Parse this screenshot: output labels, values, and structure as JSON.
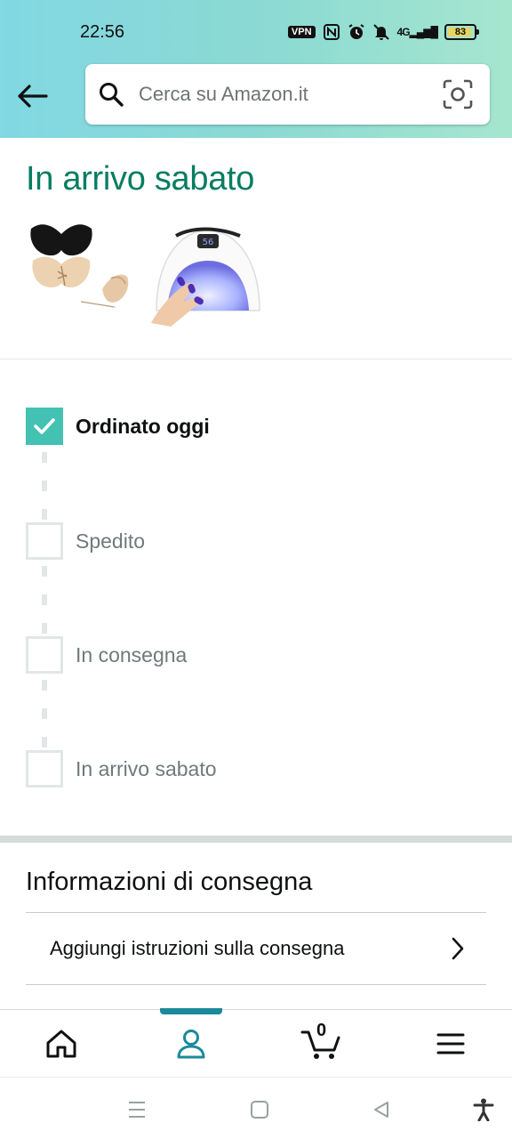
{
  "status_bar": {
    "time": "22:56",
    "vpn": "VPN",
    "network": "4G",
    "battery": "83"
  },
  "header": {
    "search_placeholder": "Cerca su Amazon.it",
    "accent": "#067D62"
  },
  "delivery": {
    "title": "In arrivo sabato",
    "products": [
      {
        "name": "bra-product-thumbnail"
      },
      {
        "name": "nail-lamp-product-thumbnail"
      }
    ]
  },
  "tracker": {
    "steps": [
      {
        "label": "Ordinato oggi",
        "done": true
      },
      {
        "label": "Spedito",
        "done": false
      },
      {
        "label": "In consegna",
        "done": false
      },
      {
        "label": "In arrivo sabato",
        "done": false
      }
    ]
  },
  "info": {
    "title": "Informazioni di consegna",
    "add_instructions": "Aggiungi istruzioni sulla consegna"
  },
  "bottom_nav": {
    "cart_count": "0",
    "active": "account"
  }
}
